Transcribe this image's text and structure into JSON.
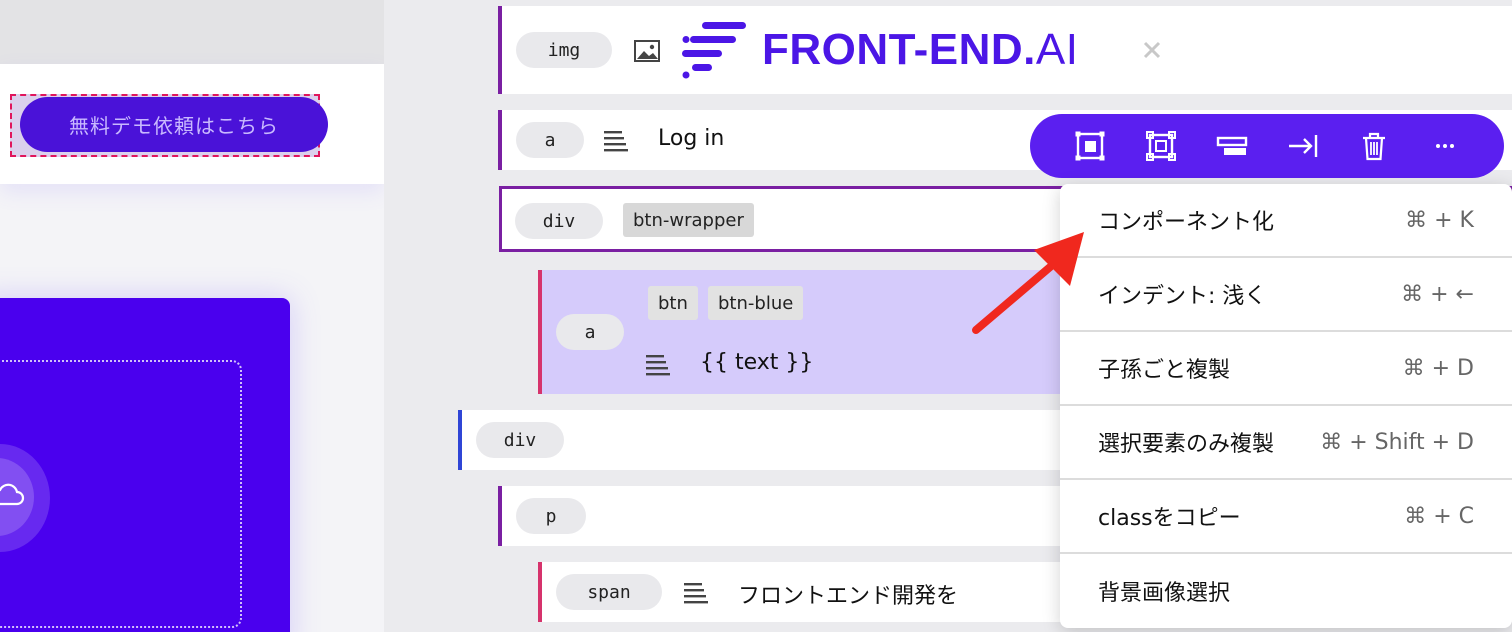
{
  "preview": {
    "demo_button_label": "無料デモ依頼はこちら"
  },
  "tree": {
    "img_node": {
      "tag": "img",
      "logo_text_bold": "FRONT-END.",
      "logo_text_thin": "AI"
    },
    "a_login_node": {
      "tag": "a",
      "text": "Log in"
    },
    "div_wrapper_node": {
      "tag": "div",
      "classes": [
        "btn-wrapper"
      ]
    },
    "a_btn_node": {
      "tag": "a",
      "classes": [
        "btn",
        "btn-blue"
      ],
      "text": "{{ text }}"
    },
    "div_node": {
      "tag": "div"
    },
    "p_node": {
      "tag": "p"
    },
    "span_node": {
      "tag": "span",
      "text": "フロントエンド開発を"
    }
  },
  "toolbar": {
    "icons": [
      "select-parent-icon",
      "select-component-icon",
      "wrap-icon",
      "indent-icon",
      "trash-icon",
      "more-icon"
    ]
  },
  "menu": {
    "items": [
      {
        "label": "コンポーネント化",
        "shortcut": "⌘ + K"
      },
      {
        "label": "インデント: 浅く",
        "shortcut": "⌘ + ←"
      },
      {
        "label": "子孫ごと複製",
        "shortcut": "⌘ + D"
      },
      {
        "label": "選択要素のみ複製",
        "shortcut": "⌘ + Shift + D"
      },
      {
        "label": "classをコピー",
        "shortcut": "⌘ + C"
      },
      {
        "label": "背景画像選択",
        "shortcut": ""
      }
    ]
  },
  "colors": {
    "accent": "#5b1ff0",
    "node_border": "#7a1fa2",
    "selected_bg": "#d5cbfb",
    "annotation_arrow": "#f0281e"
  }
}
